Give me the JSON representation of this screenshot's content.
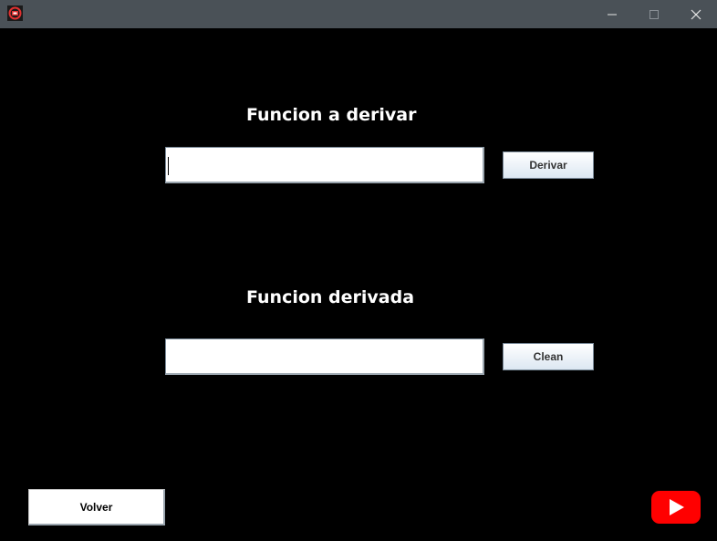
{
  "window": {
    "controls": {
      "minimize": "—",
      "maximize": "☐",
      "close": "✕"
    }
  },
  "main": {
    "input_heading": "Funcion a derivar",
    "input_field": {
      "value": "",
      "placeholder": ""
    },
    "derive_button": "Derivar",
    "output_heading": "Funcion derivada",
    "output_field": {
      "value": "",
      "placeholder": ""
    },
    "clean_button": "Clean",
    "back_button": "Volver"
  },
  "icons": {
    "app": "app-logo-icon",
    "youtube": "youtube-icon"
  },
  "colors": {
    "background": "#000000",
    "titlebar": "#4a5157",
    "youtube_red": "#ff0000"
  }
}
